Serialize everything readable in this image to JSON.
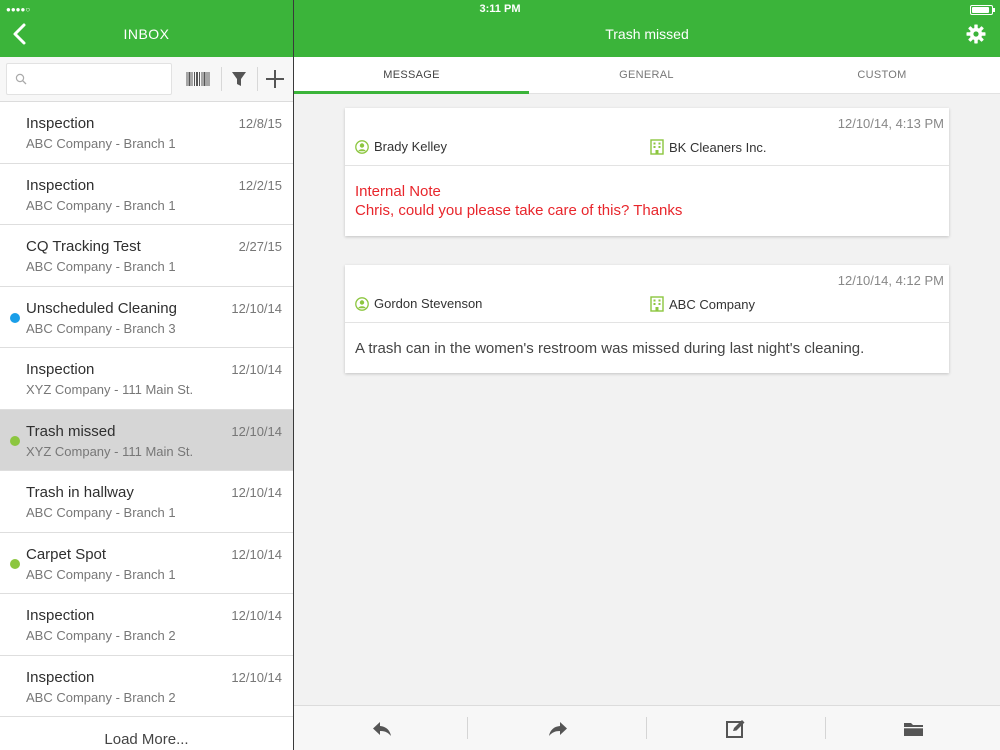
{
  "status": {
    "signal": "●●●●○",
    "time": "3:11 PM",
    "battery_level": 0.9
  },
  "left_header": {
    "title": "INBOX"
  },
  "header": {
    "title": "Trash missed"
  },
  "search": {
    "placeholder": ""
  },
  "inbox": {
    "items": [
      {
        "title": "Inspection",
        "subtitle": "ABC Company - Branch 1",
        "date": "12/8/15"
      },
      {
        "title": "Inspection",
        "subtitle": "ABC Company - Branch 1",
        "date": "12/2/15"
      },
      {
        "title": "CQ Tracking Test",
        "subtitle": "ABC Company - Branch 1",
        "date": "2/27/15"
      },
      {
        "title": "Unscheduled Cleaning",
        "subtitle": "ABC Company - Branch 3",
        "date": "12/10/14",
        "dot": "#1a9ee8"
      },
      {
        "title": "Inspection",
        "subtitle": "XYZ Company - 111 Main St.",
        "date": "12/10/14"
      },
      {
        "title": "Trash missed",
        "subtitle": "XYZ Company - 111 Main St.",
        "date": "12/10/14",
        "dot": "#8cc63f",
        "selected": true
      },
      {
        "title": "Trash in hallway",
        "subtitle": "ABC Company - Branch 1",
        "date": "12/10/14"
      },
      {
        "title": "Carpet Spot",
        "subtitle": "ABC Company - Branch 1",
        "date": "12/10/14",
        "dot": "#8cc63f"
      },
      {
        "title": "Inspection",
        "subtitle": "ABC Company - Branch 2",
        "date": "12/10/14"
      },
      {
        "title": "Inspection",
        "subtitle": "ABC Company - Branch 2",
        "date": "12/10/14"
      }
    ],
    "load_more": "Load More..."
  },
  "tabs": [
    {
      "label": "MESSAGE",
      "active": true
    },
    {
      "label": "GENERAL"
    },
    {
      "label": "CUSTOM"
    }
  ],
  "messages": [
    {
      "timestamp": "12/10/14, 4:13 PM",
      "person": "Brady Kelley",
      "company": "BK Cleaners Inc.",
      "note_label": "Internal Note",
      "text": "Chris, could you please take care of this? Thanks"
    },
    {
      "timestamp": "12/10/14, 4:12 PM",
      "person": "Gordon Stevenson",
      "company": "ABC Company",
      "text": "A trash can in the women's restroom was missed during last night's cleaning."
    }
  ],
  "colors": {
    "accent": "#3bb43a",
    "note": "#e8262c",
    "unread_blue": "#1a9ee8",
    "unread_green": "#8cc63f"
  },
  "icons": {
    "toolbar": [
      "barcode-icon",
      "filter-icon",
      "add-icon"
    ],
    "bottom": [
      "reply-icon",
      "forward-icon",
      "compose-icon",
      "folder-icon"
    ]
  }
}
